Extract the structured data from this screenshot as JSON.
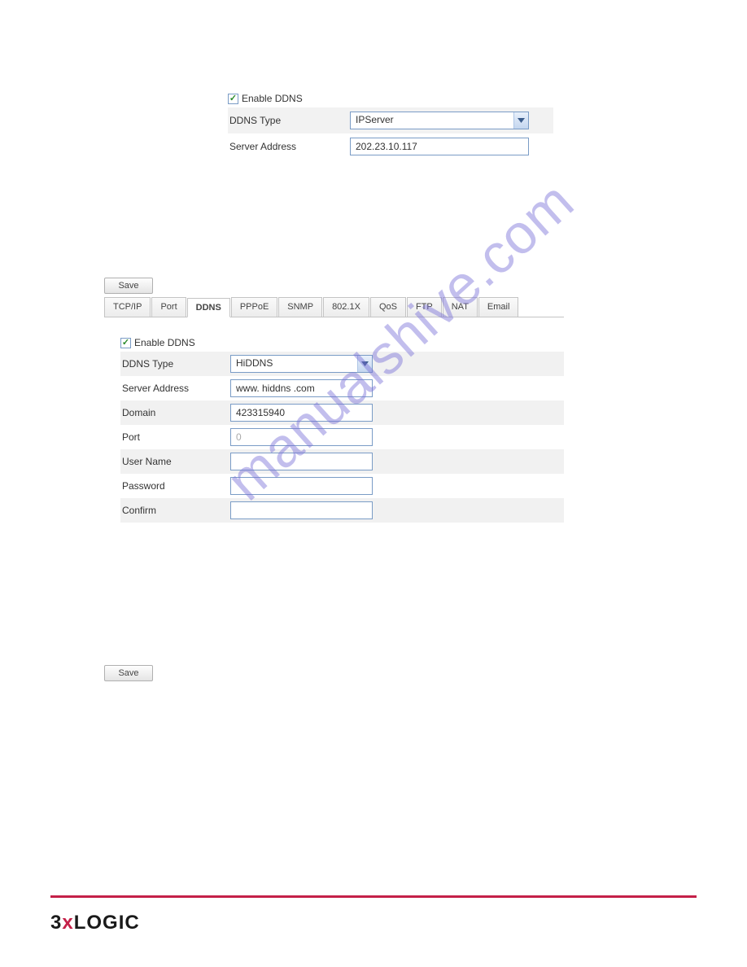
{
  "section1": {
    "enable_label": "Enable DDNS",
    "type_label": "DDNS Type",
    "type_value": "IPServer",
    "server_label": "Server Address",
    "server_value": "202.23.10.117"
  },
  "save_label": "Save",
  "tabs": [
    "TCP/IP",
    "Port",
    "DDNS",
    "PPPoE",
    "SNMP",
    "802.1X",
    "QoS",
    "FTP",
    "NAT",
    "Email"
  ],
  "active_tab": "DDNS",
  "section2": {
    "enable_label": "Enable DDNS",
    "type_label": "DDNS Type",
    "type_value": "HiDDNS",
    "server_label": "Server Address",
    "server_value": "www. hiddns .com",
    "domain_label": "Domain",
    "domain_value": "423315940",
    "port_label": "Port",
    "port_value": "0",
    "user_label": "User Name",
    "user_value": "",
    "password_label": "Password",
    "password_value": "",
    "confirm_label": "Confirm",
    "confirm_value": ""
  },
  "watermark": "manualshive.com",
  "footer_logo_parts": [
    "3",
    "x",
    "LOGIC"
  ]
}
